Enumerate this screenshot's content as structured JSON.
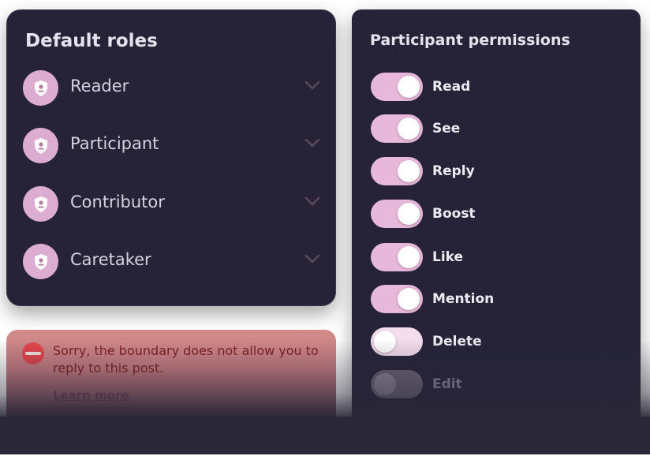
{
  "roles_panel": {
    "title": "Default roles",
    "items": [
      {
        "label": "Reader",
        "icon": "shield-user-icon"
      },
      {
        "label": "Participant",
        "icon": "shield-user-icon"
      },
      {
        "label": "Contributor",
        "icon": "shield-user-icon"
      },
      {
        "label": "Caretaker",
        "icon": "shield-user-icon"
      }
    ]
  },
  "permissions_panel": {
    "title": "Participant permissions",
    "items": [
      {
        "label": "Read",
        "state": "on"
      },
      {
        "label": "See",
        "state": "on"
      },
      {
        "label": "Reply",
        "state": "on"
      },
      {
        "label": "Boost",
        "state": "on"
      },
      {
        "label": "Like",
        "state": "on"
      },
      {
        "label": "Mention",
        "state": "on"
      },
      {
        "label": "Delete",
        "state": "off"
      },
      {
        "label": "Edit",
        "state": "disabled"
      }
    ]
  },
  "alert": {
    "icon": "no-entry-icon",
    "message": "Sorry, the boundary does not allow you to reply to this post.",
    "link": "Learn more"
  },
  "colors": {
    "panel_bg": "#262339",
    "accent": "#e7b8d9",
    "alert_bg": "#d38a8a",
    "alert_icon": "#e4464b"
  }
}
